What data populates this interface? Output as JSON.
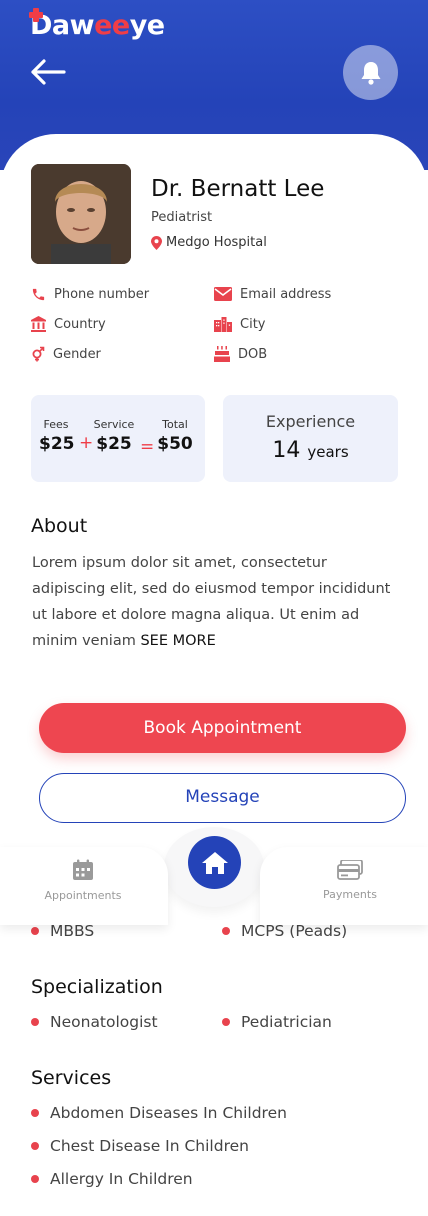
{
  "header": {
    "logo_prefix": "Daw",
    "logo_red": "ee",
    "logo_suffix": "ye",
    "back_icon": "arrow-left-icon",
    "notification_icon": "bell-icon"
  },
  "doctor": {
    "name": "Dr. Bernatt Lee",
    "specialty": "Pediatrist",
    "hospital": "Medgo Hospital"
  },
  "contact": {
    "phone_label": "Phone number",
    "email_label": "Email address",
    "country_label": "Country",
    "city_label": "City",
    "gender_label": "Gender",
    "dob_label": "DOB"
  },
  "pricing": {
    "fees_label": "Fees",
    "fees_value": "$25",
    "service_label": "Service",
    "service_value": "$25",
    "total_label": "Total",
    "total_value": "$50",
    "plus": "+",
    "equals": "="
  },
  "experience": {
    "title": "Experience",
    "value": "14",
    "unit": "years"
  },
  "about": {
    "heading": "About",
    "text": "Lorem ipsum dolor sit amet, consectetur adipiscing elit, sed do eiusmod tempor incididunt ut labore et dolore magna aliqua. Ut enim ad minim veniam ",
    "see_more": "SEE MORE"
  },
  "actions": {
    "book": "Book Appointment",
    "message": "Message"
  },
  "nav": {
    "appointments": "Appointments",
    "payments": "Payments"
  },
  "qualifications": [
    "MBBS",
    "MCPS (Peads)"
  ],
  "specialization": {
    "heading": "Specialization",
    "items": [
      "Neonatologist",
      "Pediatrician"
    ]
  },
  "services": {
    "heading": "Services",
    "items": [
      "Abdomen Diseases In Children",
      "Chest Disease In Children",
      "Allergy In Children"
    ]
  },
  "colors": {
    "primary": "#2443b8",
    "accent": "#ee4650",
    "soft_card": "#eef1fb"
  }
}
